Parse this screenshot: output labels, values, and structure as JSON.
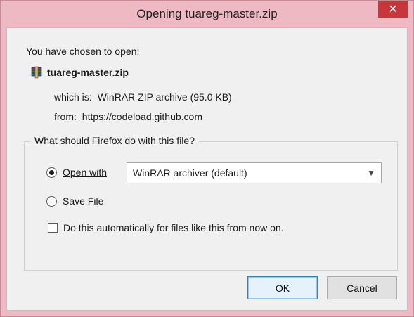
{
  "window": {
    "title": "Opening tuareg-master.zip",
    "close_label": "✕"
  },
  "content": {
    "chosen_label": "You have chosen to open:",
    "file_name": "tuareg-master.zip",
    "which_label": "which is:",
    "which_value": "WinRAR ZIP archive (95.0 KB)",
    "from_label": "from:",
    "from_value": "https://codeload.github.com"
  },
  "group": {
    "label": "What should Firefox do with this file?",
    "open_with_label": "Open with",
    "open_with_selected": true,
    "app_select_value": "WinRAR archiver (default)",
    "save_file_label": "Save File",
    "save_file_selected": false,
    "auto_label": "Do this automatically for files like this from now on.",
    "auto_checked": false
  },
  "buttons": {
    "ok": "OK",
    "cancel": "Cancel"
  },
  "icons": {
    "file": "winrar-archive-icon",
    "dropdown": "chevron-down-icon",
    "close": "close-icon"
  },
  "colors": {
    "frame": "#efb9c3",
    "close": "#c7363a",
    "client_bg": "#f0f0f0"
  }
}
